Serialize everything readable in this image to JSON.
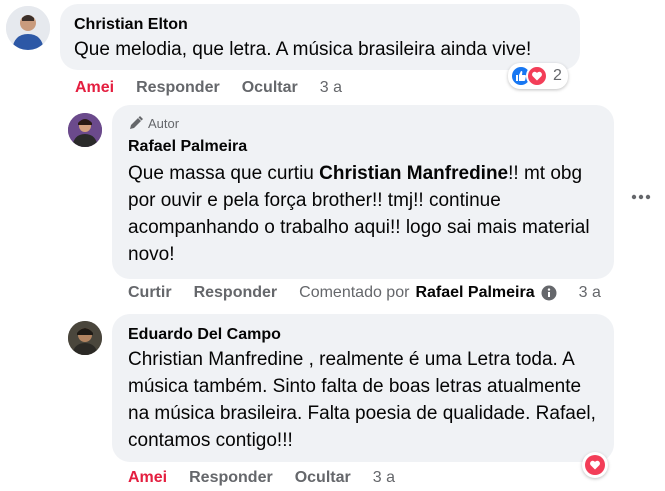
{
  "comments": [
    {
      "author": "Christian Elton",
      "text": "Que melodia, que letra. A música brasileira ainda vive!",
      "actions": {
        "like": "Amei",
        "reply": "Responder",
        "hide": "Ocultar",
        "time": "3 a"
      },
      "reactions": {
        "icons": [
          "like-icon",
          "love-icon"
        ],
        "count": "2"
      }
    },
    {
      "author_tag": "Autor",
      "author": "Rafael Palmeira",
      "text_pre": "Que massa que curtiu ",
      "mention": "Christian Manfredine",
      "text_post": "!! mt obg por ouvir e pela força brother!! tmj!! continue acompanhando o trabalho aqui!! logo sai mais material novo!",
      "actions": {
        "like": "Curtir",
        "reply": "Responder",
        "commented_by_prefix": "Comentado por",
        "commented_by_name": "Rafael Palmeira",
        "time": "3 a"
      }
    },
    {
      "author": "Eduardo Del Campo",
      "text": "Christian Manfredine , realmente é uma Letra toda. A música também. Sinto falta de boas letras atualmente na música brasileira. Falta poesia de qualidade. Rafael, contamos contigo!!!",
      "actions": {
        "like": "Amei",
        "reply": "Responder",
        "hide": "Ocultar",
        "time": "3 a"
      },
      "reactions": {
        "icons": [
          "love-icon"
        ]
      }
    }
  ],
  "colors": {
    "loved": "#e41e3f",
    "muted": "#65676b",
    "bubble": "#f0f2f5",
    "like_blue": "#1877f2"
  }
}
